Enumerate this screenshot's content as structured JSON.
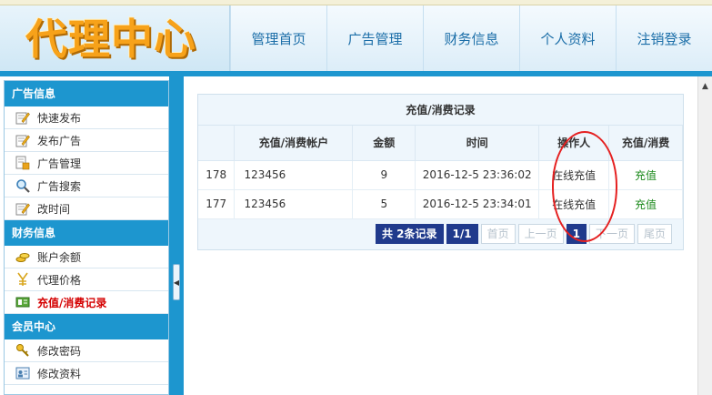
{
  "header": {
    "logo_text": "代理中心",
    "nav": [
      "管理首页",
      "广告管理",
      "财务信息",
      "个人资料",
      "注销登录"
    ]
  },
  "sidebar": {
    "sections": [
      {
        "title": "广告信息",
        "items": [
          {
            "label": "快速发布",
            "icon": "edit-icon"
          },
          {
            "label": "发布广告",
            "icon": "edit-icon"
          },
          {
            "label": "广告管理",
            "icon": "manage-icon"
          },
          {
            "label": "广告搜索",
            "icon": "search-icon"
          },
          {
            "label": "改时间",
            "icon": "edit-icon"
          }
        ]
      },
      {
        "title": "财务信息",
        "items": [
          {
            "label": "账户余额",
            "icon": "coins-icon"
          },
          {
            "label": "代理价格",
            "icon": "price-icon"
          },
          {
            "label": "充值/消费记录",
            "icon": "record-icon",
            "active": true
          }
        ]
      },
      {
        "title": "会员中心",
        "items": [
          {
            "label": "修改密码",
            "icon": "key-icon"
          },
          {
            "label": "修改资料",
            "icon": "profile-icon"
          }
        ]
      }
    ]
  },
  "records": {
    "title": "充值/消费记录",
    "columns": [
      "",
      "充值/消费帐户",
      "金额",
      "时间",
      "操作人",
      "充值/消费"
    ],
    "rows": [
      [
        "178",
        "123456",
        "9",
        "2016-12-5 23:36:02",
        "在线充值",
        "充值"
      ],
      [
        "177",
        "123456",
        "5",
        "2016-12-5 23:34:01",
        "在线充值",
        "充值"
      ]
    ]
  },
  "pager": {
    "total": "共 2条记录",
    "pages": "1/1",
    "first": "首页",
    "prev": "上一页",
    "current": "1",
    "next": "下一页",
    "last": "尾页"
  },
  "colors": {
    "accent": "#1d96cf",
    "logo": "#f7a21a",
    "active": "#d40000",
    "pager_dark": "#203a8c",
    "annotation": "#e52020"
  }
}
